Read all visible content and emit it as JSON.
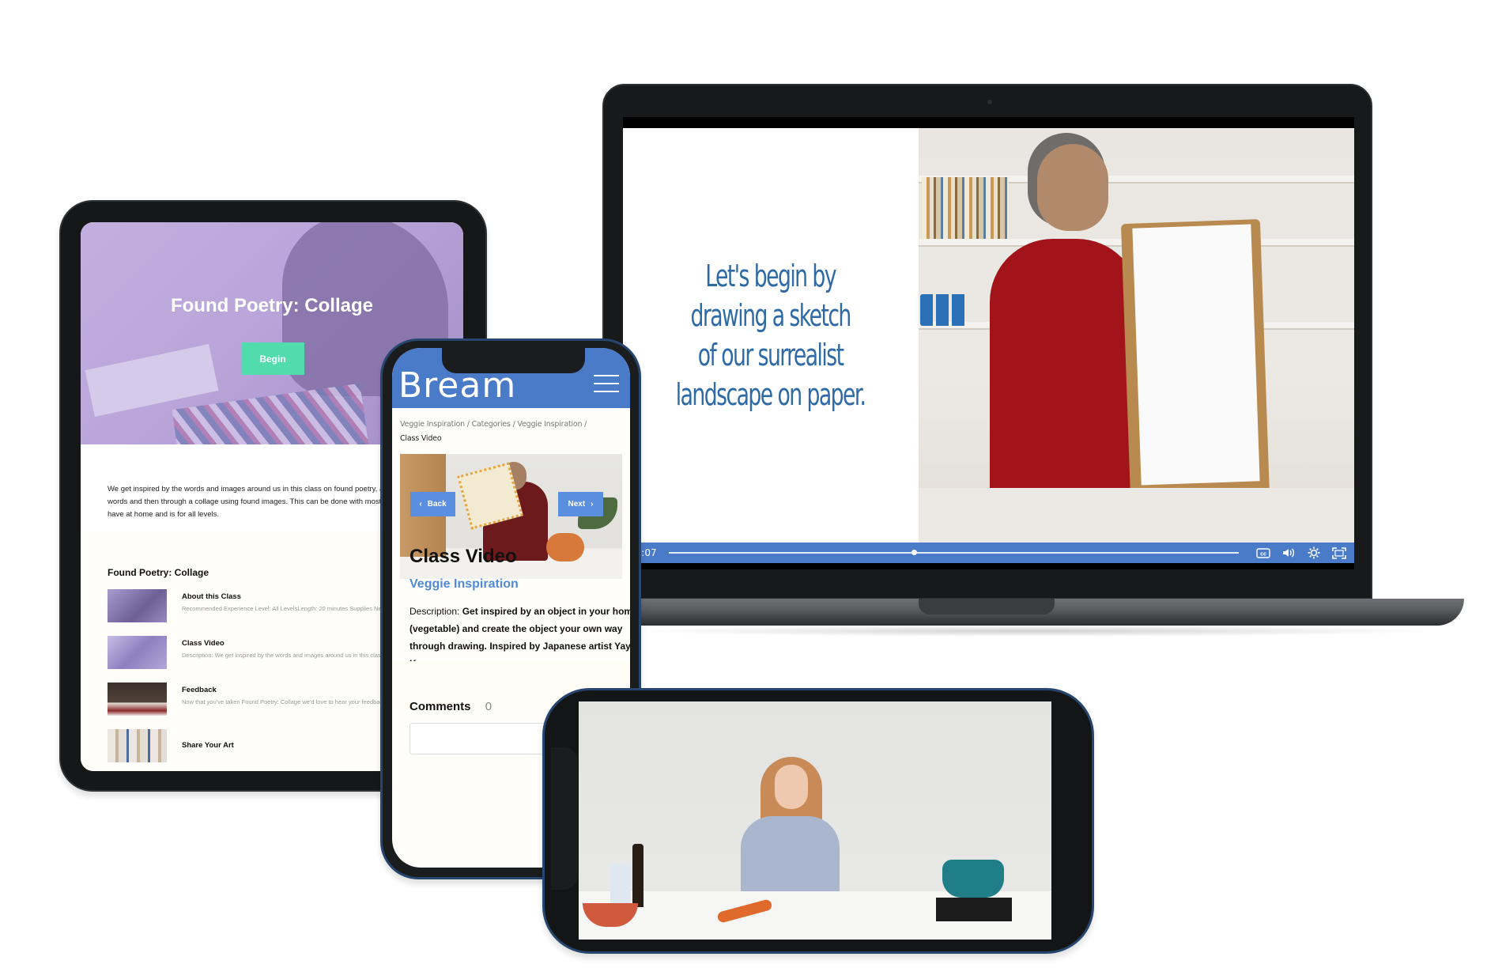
{
  "laptop": {
    "slide_text": "Let's begin by\ndrawing a sketch\nof our surrealist\nlandscape on paper.",
    "player": {
      "time": "16:07",
      "progress_percent": 43,
      "controls": [
        {
          "name": "cc-icon",
          "glyph": "CC"
        },
        {
          "name": "volume-icon",
          "glyph": "◀))"
        },
        {
          "name": "settings-icon",
          "glyph": "☼"
        },
        {
          "name": "fullscreen-icon",
          "glyph": "⛶"
        }
      ],
      "bar_color": "#4a7bc9"
    }
  },
  "tablet": {
    "hero": {
      "title": "Found Poetry: Collage",
      "begin_label": "Begin",
      "button_color": "#52dcae"
    },
    "description": "We get inspired by the words and images around us in this class on found poetry, a poem using found words and then through a collage using found images. This can be done with most any supplies you have at home and is for all levels.",
    "course_title": "Found Poetry: Collage",
    "lessons": [
      {
        "title": "About this Class",
        "desc": "Recommended Experience Level: All LevelsLength: 20 minutes Supplies Needed: Drawing paper Writin..."
      },
      {
        "title": "Class Video",
        "desc": "Description: We get inspired by the words and images around us in this class on found poetry. Fir..."
      },
      {
        "title": "Feedback",
        "desc": "Now that you've taken Found Poetry: Collage we'd love to hear your feedback. It will take about 2..."
      },
      {
        "title": "Share Your Art",
        "desc": ""
      }
    ]
  },
  "phone": {
    "logo": "Bream",
    "brand_color": "#4a7bc9",
    "breadcrumb": {
      "trail": "Veggie Inspiration / Categories / Veggie Inspiration /",
      "current": "Class Video"
    },
    "back_label": "Back",
    "next_label": "Next",
    "title": "Class Video",
    "category": "Veggie Inspiration",
    "description_label": "Description:",
    "description_text": "Get inspired by an object in your home (vegetable) and create the object your own way through drawing. Inspired by Japanese artist Yayoi Kusama.",
    "comments_label": "Comments",
    "comments_count": "0"
  }
}
